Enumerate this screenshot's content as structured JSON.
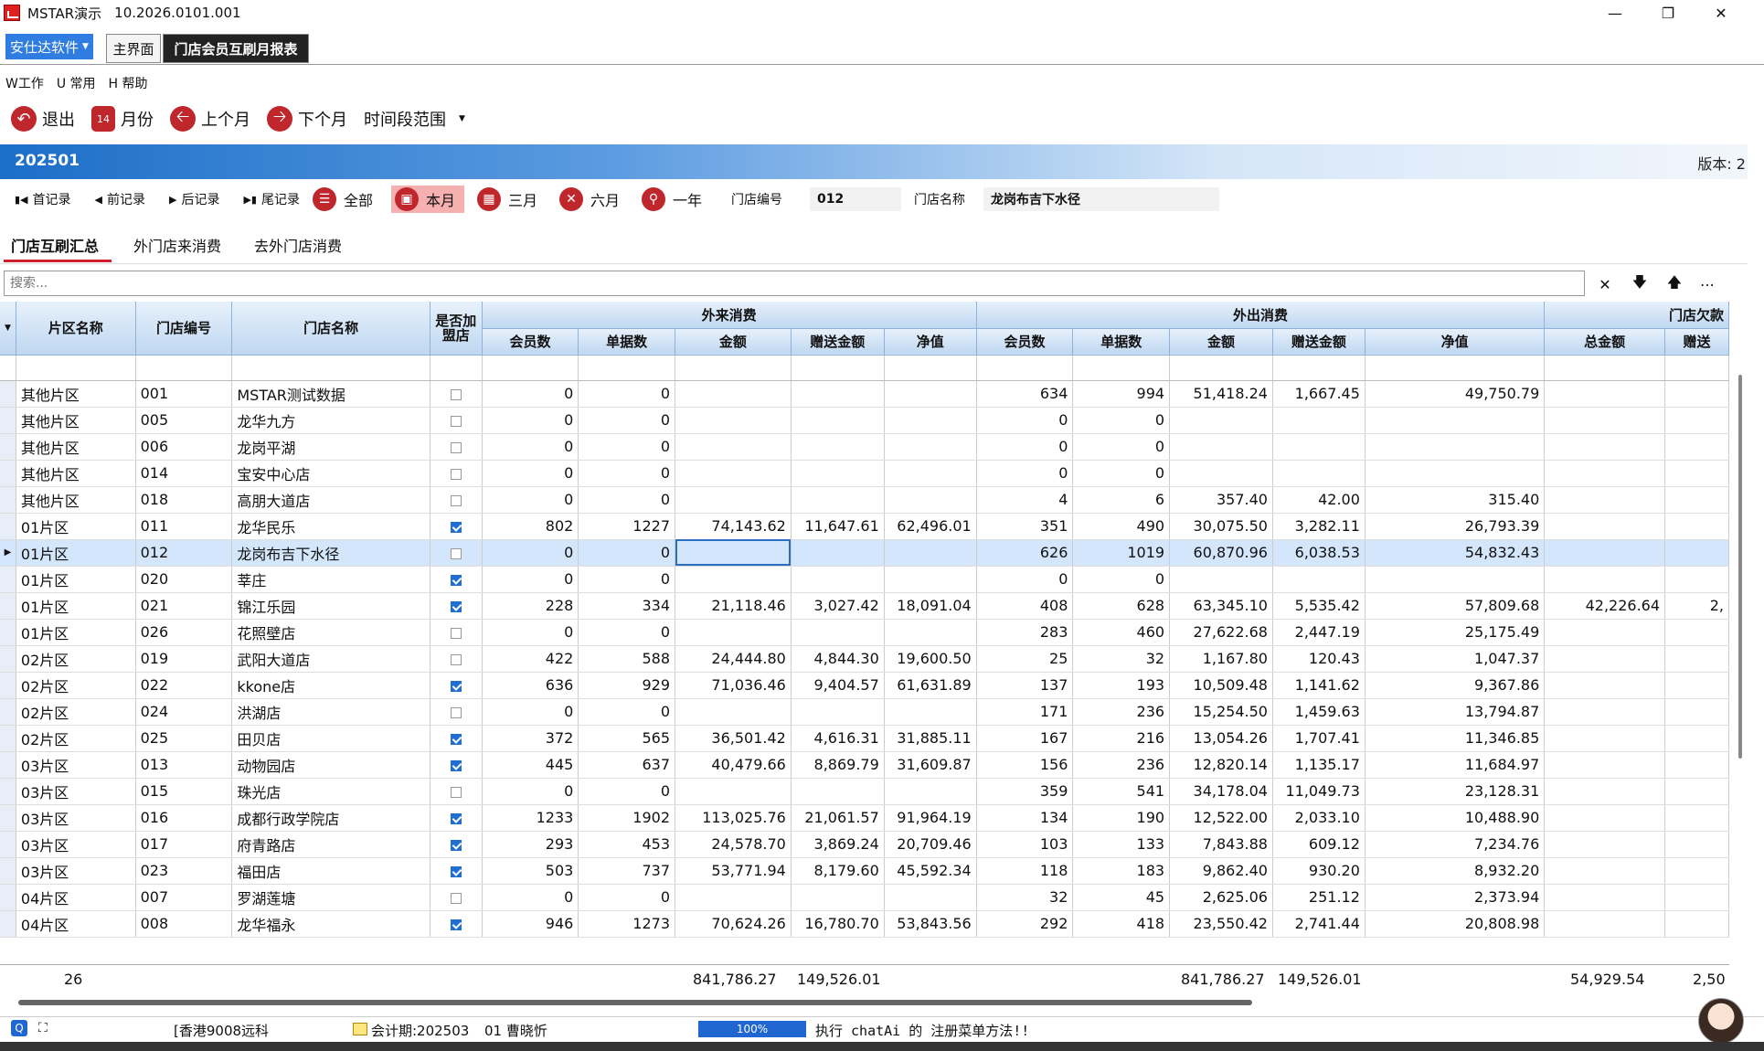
{
  "window": {
    "title": "MSTAR演示",
    "version": "10.2026.0101.001"
  },
  "tabs": {
    "software_menu": "安仕达软件",
    "home": "主界面",
    "active": "门店会员互刷月报表"
  },
  "menu": [
    "W工作",
    "U 常用",
    "H 帮助"
  ],
  "toolbar": {
    "exit": "退出",
    "month": "月份",
    "month_icon_text": "14",
    "prev_month": "上个月",
    "next_month": "下个月",
    "range": "时间段范围"
  },
  "header": {
    "period": "202501",
    "version_label": "版本: 2"
  },
  "nav": {
    "first": "首记录",
    "prev": "前记录",
    "next": "后记录",
    "last": "尾记录"
  },
  "filters": {
    "all": "全部",
    "this_month": "本月",
    "three_months": "三月",
    "six_months": "六月",
    "one_year": "一年"
  },
  "store": {
    "code_label": "门店编号",
    "code_value": "012",
    "name_label": "门店名称",
    "name_value": "龙岗布吉下水径"
  },
  "subtabs": [
    "门店互刷汇总",
    "外门店来消费",
    "去外门店消费"
  ],
  "search": {
    "placeholder": "搜索..."
  },
  "columns": {
    "area": "片区名称",
    "code": "门店编号",
    "name": "门店名称",
    "franchise": "是否加盟店",
    "group_in": "外来消费",
    "group_out": "外出消费",
    "group_store": "门店欠款",
    "members": "会员数",
    "bills": "单据数",
    "amount": "金额",
    "gift": "赠送金额",
    "net": "净值",
    "total": "总金额",
    "gift_short": "赠送"
  },
  "rows": [
    {
      "area": "其他片区",
      "code": "001",
      "name": "MSTAR测试数据",
      "f": false,
      "in_m": "0",
      "in_b": "0",
      "in_a": "",
      "in_g": "",
      "in_n": "",
      "out_m": "634",
      "out_b": "994",
      "out_a": "51,418.24",
      "out_g": "1,667.45",
      "out_n": "49,750.79",
      "tot": "",
      "tg": ""
    },
    {
      "area": "其他片区",
      "code": "005",
      "name": "龙华九方",
      "f": false,
      "in_m": "0",
      "in_b": "0",
      "in_a": "",
      "in_g": "",
      "in_n": "",
      "out_m": "0",
      "out_b": "0",
      "out_a": "",
      "out_g": "",
      "out_n": "",
      "tot": "",
      "tg": ""
    },
    {
      "area": "其他片区",
      "code": "006",
      "name": "龙岗平湖",
      "f": false,
      "in_m": "0",
      "in_b": "0",
      "in_a": "",
      "in_g": "",
      "in_n": "",
      "out_m": "0",
      "out_b": "0",
      "out_a": "",
      "out_g": "",
      "out_n": "",
      "tot": "",
      "tg": ""
    },
    {
      "area": "其他片区",
      "code": "014",
      "name": "宝安中心店",
      "f": false,
      "in_m": "0",
      "in_b": "0",
      "in_a": "",
      "in_g": "",
      "in_n": "",
      "out_m": "0",
      "out_b": "0",
      "out_a": "",
      "out_g": "",
      "out_n": "",
      "tot": "",
      "tg": ""
    },
    {
      "area": "其他片区",
      "code": "018",
      "name": "高朋大道店",
      "f": false,
      "in_m": "0",
      "in_b": "0",
      "in_a": "",
      "in_g": "",
      "in_n": "",
      "out_m": "4",
      "out_b": "6",
      "out_a": "357.40",
      "out_g": "42.00",
      "out_n": "315.40",
      "tot": "",
      "tg": ""
    },
    {
      "area": "01片区",
      "code": "011",
      "name": "龙华民乐",
      "f": true,
      "in_m": "802",
      "in_b": "1227",
      "in_a": "74,143.62",
      "in_g": "11,647.61",
      "in_n": "62,496.01",
      "out_m": "351",
      "out_b": "490",
      "out_a": "30,075.50",
      "out_g": "3,282.11",
      "out_n": "26,793.39",
      "tot": "",
      "tg": ""
    },
    {
      "area": "01片区",
      "code": "012",
      "name": "龙岗布吉下水径",
      "f": false,
      "in_m": "0",
      "in_b": "0",
      "in_a": "",
      "in_g": "",
      "in_n": "",
      "out_m": "626",
      "out_b": "1019",
      "out_a": "60,870.96",
      "out_g": "6,038.53",
      "out_n": "54,832.43",
      "tot": "",
      "tg": "",
      "sel": true
    },
    {
      "area": "01片区",
      "code": "020",
      "name": "莘庄",
      "f": true,
      "in_m": "0",
      "in_b": "0",
      "in_a": "",
      "in_g": "",
      "in_n": "",
      "out_m": "0",
      "out_b": "0",
      "out_a": "",
      "out_g": "",
      "out_n": "",
      "tot": "",
      "tg": ""
    },
    {
      "area": "01片区",
      "code": "021",
      "name": "锦江乐园",
      "f": true,
      "in_m": "228",
      "in_b": "334",
      "in_a": "21,118.46",
      "in_g": "3,027.42",
      "in_n": "18,091.04",
      "out_m": "408",
      "out_b": "628",
      "out_a": "63,345.10",
      "out_g": "5,535.42",
      "out_n": "57,809.68",
      "tot": "42,226.64",
      "tg": "2,"
    },
    {
      "area": "01片区",
      "code": "026",
      "name": "花照壁店",
      "f": false,
      "in_m": "0",
      "in_b": "0",
      "in_a": "",
      "in_g": "",
      "in_n": "",
      "out_m": "283",
      "out_b": "460",
      "out_a": "27,622.68",
      "out_g": "2,447.19",
      "out_n": "25,175.49",
      "tot": "",
      "tg": ""
    },
    {
      "area": "02片区",
      "code": "019",
      "name": "武阳大道店",
      "f": false,
      "in_m": "422",
      "in_b": "588",
      "in_a": "24,444.80",
      "in_g": "4,844.30",
      "in_n": "19,600.50",
      "out_m": "25",
      "out_b": "32",
      "out_a": "1,167.80",
      "out_g": "120.43",
      "out_n": "1,047.37",
      "tot": "",
      "tg": ""
    },
    {
      "area": "02片区",
      "code": "022",
      "name": "kkone店",
      "f": true,
      "in_m": "636",
      "in_b": "929",
      "in_a": "71,036.46",
      "in_g": "9,404.57",
      "in_n": "61,631.89",
      "out_m": "137",
      "out_b": "193",
      "out_a": "10,509.48",
      "out_g": "1,141.62",
      "out_n": "9,367.86",
      "tot": "",
      "tg": ""
    },
    {
      "area": "02片区",
      "code": "024",
      "name": "洪湖店",
      "f": false,
      "in_m": "0",
      "in_b": "0",
      "in_a": "",
      "in_g": "",
      "in_n": "",
      "out_m": "171",
      "out_b": "236",
      "out_a": "15,254.50",
      "out_g": "1,459.63",
      "out_n": "13,794.87",
      "tot": "",
      "tg": ""
    },
    {
      "area": "02片区",
      "code": "025",
      "name": "田贝店",
      "f": true,
      "in_m": "372",
      "in_b": "565",
      "in_a": "36,501.42",
      "in_g": "4,616.31",
      "in_n": "31,885.11",
      "out_m": "167",
      "out_b": "216",
      "out_a": "13,054.26",
      "out_g": "1,707.41",
      "out_n": "11,346.85",
      "tot": "",
      "tg": ""
    },
    {
      "area": "03片区",
      "code": "013",
      "name": "动物园店",
      "f": true,
      "in_m": "445",
      "in_b": "637",
      "in_a": "40,479.66",
      "in_g": "8,869.79",
      "in_n": "31,609.87",
      "out_m": "156",
      "out_b": "236",
      "out_a": "12,820.14",
      "out_g": "1,135.17",
      "out_n": "11,684.97",
      "tot": "",
      "tg": ""
    },
    {
      "area": "03片区",
      "code": "015",
      "name": "珠光店",
      "f": false,
      "in_m": "0",
      "in_b": "0",
      "in_a": "",
      "in_g": "",
      "in_n": "",
      "out_m": "359",
      "out_b": "541",
      "out_a": "34,178.04",
      "out_g": "11,049.73",
      "out_n": "23,128.31",
      "tot": "",
      "tg": ""
    },
    {
      "area": "03片区",
      "code": "016",
      "name": "成都行政学院店",
      "f": true,
      "in_m": "1233",
      "in_b": "1902",
      "in_a": "113,025.76",
      "in_g": "21,061.57",
      "in_n": "91,964.19",
      "out_m": "134",
      "out_b": "190",
      "out_a": "12,522.00",
      "out_g": "2,033.10",
      "out_n": "10,488.90",
      "tot": "",
      "tg": ""
    },
    {
      "area": "03片区",
      "code": "017",
      "name": "府青路店",
      "f": true,
      "in_m": "293",
      "in_b": "453",
      "in_a": "24,578.70",
      "in_g": "3,869.24",
      "in_n": "20,709.46",
      "out_m": "103",
      "out_b": "133",
      "out_a": "7,843.88",
      "out_g": "609.12",
      "out_n": "7,234.76",
      "tot": "",
      "tg": ""
    },
    {
      "area": "03片区",
      "code": "023",
      "name": "福田店",
      "f": true,
      "in_m": "503",
      "in_b": "737",
      "in_a": "53,771.94",
      "in_g": "8,179.60",
      "in_n": "45,592.34",
      "out_m": "118",
      "out_b": "183",
      "out_a": "9,862.40",
      "out_g": "930.20",
      "out_n": "8,932.20",
      "tot": "",
      "tg": ""
    },
    {
      "area": "04片区",
      "code": "007",
      "name": "罗湖莲塘",
      "f": false,
      "in_m": "0",
      "in_b": "0",
      "in_a": "",
      "in_g": "",
      "in_n": "",
      "out_m": "32",
      "out_b": "45",
      "out_a": "2,625.06",
      "out_g": "251.12",
      "out_n": "2,373.94",
      "tot": "",
      "tg": ""
    },
    {
      "area": "04片区",
      "code": "008",
      "name": "龙华福永",
      "f": true,
      "in_m": "946",
      "in_b": "1273",
      "in_a": "70,624.26",
      "in_g": "16,780.70",
      "in_n": "53,843.56",
      "out_m": "292",
      "out_b": "418",
      "out_a": "23,550.42",
      "out_g": "2,741.44",
      "out_n": "20,808.98",
      "tot": "",
      "tg": ""
    }
  ],
  "totals": {
    "count": "26",
    "in_amount": "841,786.27",
    "in_gift": "149,526.01",
    "out_amount": "841,786.27",
    "out_gift": "149,526.01",
    "store_total": "54,929.54",
    "store_gift": "2,50"
  },
  "status": {
    "server": "[香港9008远科",
    "period": "会计期:202503",
    "user": "01 曹晓忻",
    "progress": "100%",
    "message": "执行 chatAi 的 注册菜单方法!!"
  }
}
